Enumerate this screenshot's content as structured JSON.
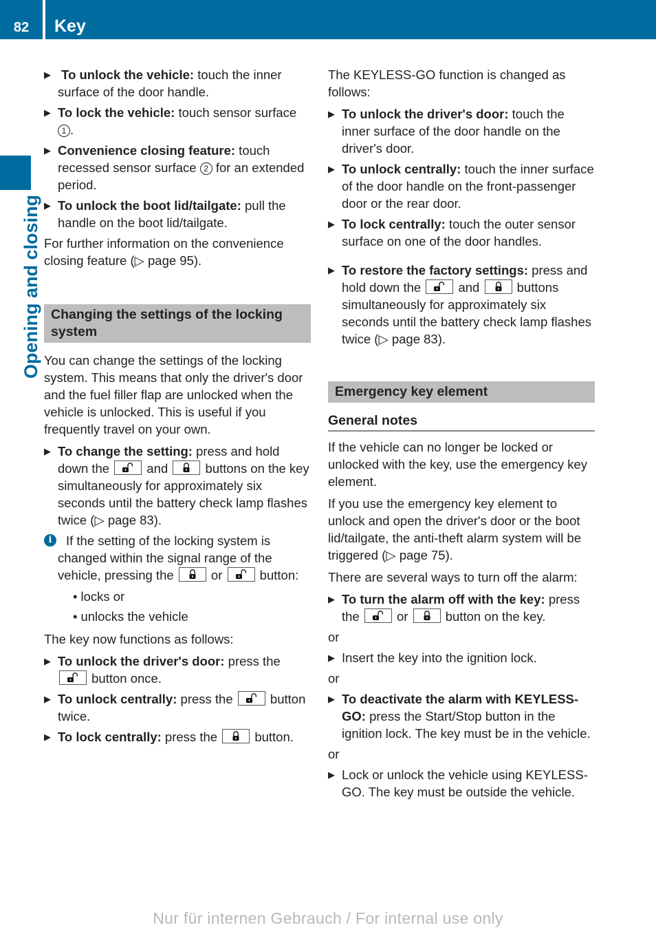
{
  "header": {
    "page_number": "82",
    "title": "Key",
    "accent_color": "#006b9e"
  },
  "side_tab": {
    "label": "Opening and closing"
  },
  "icons": {
    "unlock": "unlock-button-icon",
    "lock": "lock-button-icon",
    "arrow": "▶",
    "page_ref": "▷",
    "info": "i"
  },
  "left": {
    "steps_intro": [
      {
        "bold": "To unlock the vehicle:",
        "text": " touch the inner surface of the door handle."
      },
      {
        "bold": "To lock the vehicle:",
        "text_before": " touch sensor surface ",
        "callout": "1",
        "text_after": "."
      },
      {
        "bold": "Convenience closing feature:",
        "text_before": " touch recessed sensor surface ",
        "callout": "2",
        "text_after": " for an extended period."
      },
      {
        "bold": "To unlock the boot lid/tailgate:",
        "text": " pull the handle on the boot lid/tailgate."
      }
    ],
    "further_info": {
      "text": "For further information on the convenience closing feature (",
      "ref": "page 95",
      "end": ")."
    },
    "section_heading": "Changing the settings of the locking system",
    "section_intro": "You can change the settings of the locking system. This means that only the driver's door and the fuel filler flap are unlocked when the vehicle is unlocked. This is useful if you frequently travel on your own.",
    "change_step": {
      "bold": "To change the setting:",
      "t1": " press and hold down the ",
      "t2": " and ",
      "t3": " buttons on the key simultaneously for approximately six seconds until the battery check lamp flashes twice (",
      "ref": "page 83",
      "end": ")."
    },
    "info_note": {
      "t1": "If the setting of the locking system is changed within the signal range of the vehicle, pressing the ",
      "t2": " or ",
      "t3": " button:",
      "bullets": [
        "locks or",
        "unlocks the vehicle"
      ]
    },
    "functions_intro": "The key now functions as follows:",
    "function_steps": [
      {
        "bold": "To unlock the driver's door:",
        "t1": " press the ",
        "t2": " button once."
      },
      {
        "bold": "To unlock centrally:",
        "t1": " press the ",
        "t2": " button twice."
      },
      {
        "bold": "To lock centrally:",
        "t1": " press the ",
        "t2": " button."
      }
    ]
  },
  "right": {
    "keyless_intro": "The KEYLESS-GO function is changed as follows:",
    "keyless_steps": [
      {
        "bold": "To unlock the driver's door:",
        "text": " touch the inner surface of the door handle on the driver's door."
      },
      {
        "bold": "To unlock centrally:",
        "text": " touch the inner surface of the door handle on the front-passenger door or the rear door."
      },
      {
        "bold": "To lock centrally:",
        "text": " touch the outer sensor surface on one of the door handles."
      }
    ],
    "restore_step": {
      "bold": "To restore the factory settings:",
      "t1": " press and hold down the ",
      "t2": " and ",
      "t3": " buttons simultaneously for approximately six seconds until the battery check lamp flashes twice (",
      "ref": "page 83",
      "end": ")."
    },
    "section_heading": "Emergency key element",
    "sub_heading": "General notes",
    "para1": "If the vehicle can no longer be locked or unlocked with the key, use the emergency key element.",
    "para2": {
      "text": "If you use the emergency key element to unlock and open the driver's door or the boot lid/tailgate, the anti-theft alarm system will be triggered (",
      "ref": "page 75",
      "end": ")."
    },
    "para3": "There are several ways to turn off the alarm:",
    "alarm_key_step": {
      "bold": "To turn the alarm off with the key:",
      "t1": " press the ",
      "t2": " or ",
      "t3": " button on the key."
    },
    "or_label": "or",
    "ignition_step": "Insert the key into the ignition lock.",
    "keyless_alarm_step": {
      "bold": "To deactivate the alarm with KEYLESS-GO:",
      "text": " press the Start/Stop button in the ignition lock. The key must be in the vehicle."
    },
    "keyless_lock_step": "Lock or unlock the vehicle using KEYLESS-GO. The key must be outside the vehicle."
  },
  "footer": {
    "watermark": "Nur für internen Gebrauch / For internal use only"
  }
}
